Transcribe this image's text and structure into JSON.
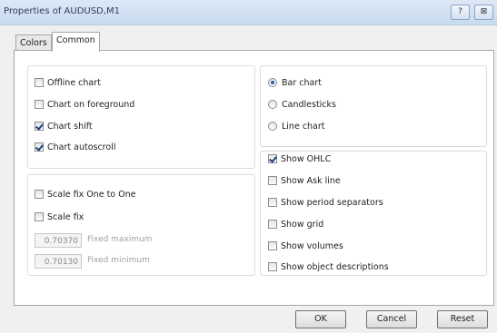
{
  "window": {
    "title": "Properties of AUDUSD,M1",
    "help_glyph": "?",
    "close_glyph": "⊠"
  },
  "tabs": [
    {
      "label": "Colors",
      "active": false
    },
    {
      "label": "Common",
      "active": true
    }
  ],
  "left_top": {
    "items": [
      {
        "label": "Offline chart",
        "checked": false
      },
      {
        "label": "Chart on foreground",
        "checked": false
      },
      {
        "label": "Chart shift",
        "checked": true
      },
      {
        "label": "Chart autoscroll",
        "checked": true
      }
    ]
  },
  "left_bottom": {
    "scale_one": {
      "label": "Scale fix One to One",
      "checked": false
    },
    "scale_fix": {
      "label": "Scale fix",
      "checked": false
    },
    "fixed_max": {
      "value": "0.70370",
      "label": "Fixed maximum"
    },
    "fixed_min": {
      "value": "0.70130",
      "label": "Fixed minimum"
    }
  },
  "right_top": {
    "items": [
      {
        "label": "Bar chart",
        "checked": true
      },
      {
        "label": "Candlesticks",
        "checked": false
      },
      {
        "label": "Line chart",
        "checked": false
      }
    ]
  },
  "right_bottom": {
    "items": [
      {
        "label": "Show OHLC",
        "checked": true
      },
      {
        "label": "Show Ask line",
        "checked": false
      },
      {
        "label": "Show period separators",
        "checked": false
      },
      {
        "label": "Show grid",
        "checked": false
      },
      {
        "label": "Show volumes",
        "checked": false
      },
      {
        "label": "Show object descriptions",
        "checked": false
      }
    ]
  },
  "buttons": {
    "ok": "OK",
    "cancel": "Cancel",
    "reset": "Reset"
  }
}
